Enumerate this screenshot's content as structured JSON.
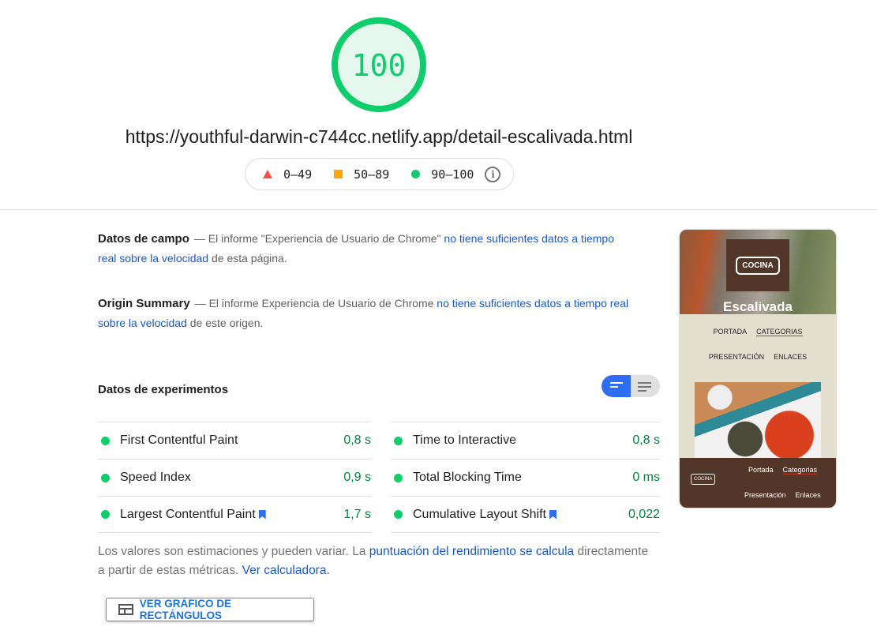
{
  "score": {
    "value": "100",
    "color": "#0cce6b"
  },
  "url": "https://youthful-darwin-c744cc.netlify.app/detail-escalivada.html",
  "legend": [
    {
      "icon": "triangle-icon",
      "label": "0–49",
      "color": "#ff4e42"
    },
    {
      "icon": "square-icon",
      "label": "50–89",
      "color": "#ffa400"
    },
    {
      "icon": "circle-icon",
      "label": "90–100",
      "color": "#0cce6b"
    }
  ],
  "field_data": {
    "title": "Datos de campo",
    "text1": "— El informe \"Experiencia de Usuario de Chrome\" ",
    "link": "no tiene suficientes datos a tiempo real sobre la velocidad",
    "text2": " de esta página."
  },
  "origin_summary": {
    "title": "Origin Summary",
    "text1": "— El informe Experiencia de Usuario de Chrome ",
    "link": "no tiene suficientes datos a tiempo real sobre la velocidad",
    "text2": " de este origen."
  },
  "lab": {
    "title": "Datos de experimentos",
    "metrics": [
      {
        "label": "First Contentful Paint",
        "value": "0,8 s"
      },
      {
        "label": "Time to Interactive",
        "value": "0,8 s"
      },
      {
        "label": "Speed Index",
        "value": "0,9 s"
      },
      {
        "label": "Total Blocking Time",
        "value": "0 ms"
      },
      {
        "label": "Largest Contentful Paint",
        "value": "1,7 s",
        "bookmark": true
      },
      {
        "label": "Cumulative Layout Shift",
        "value": "0,022",
        "bookmark": true
      }
    ]
  },
  "note": {
    "text1": "Los valores son estimaciones y pueden variar. La ",
    "link1": "puntuación del rendimiento se calcula",
    "text2": " directamente a partir de estas métricas. ",
    "link2": "Ver calculadora."
  },
  "treemap_button": "VER GRÁFICO DE RECTÁNGULOS",
  "screenshot": {
    "logo": "COCINA",
    "title": "Escalivada",
    "nav": [
      "PORTADA",
      "CATEGORIAS",
      "PRESENTACIÓN",
      "ENLACES"
    ],
    "footer_nav": [
      "Portada",
      "Categorias",
      "Presentación",
      "Enlaces"
    ]
  }
}
